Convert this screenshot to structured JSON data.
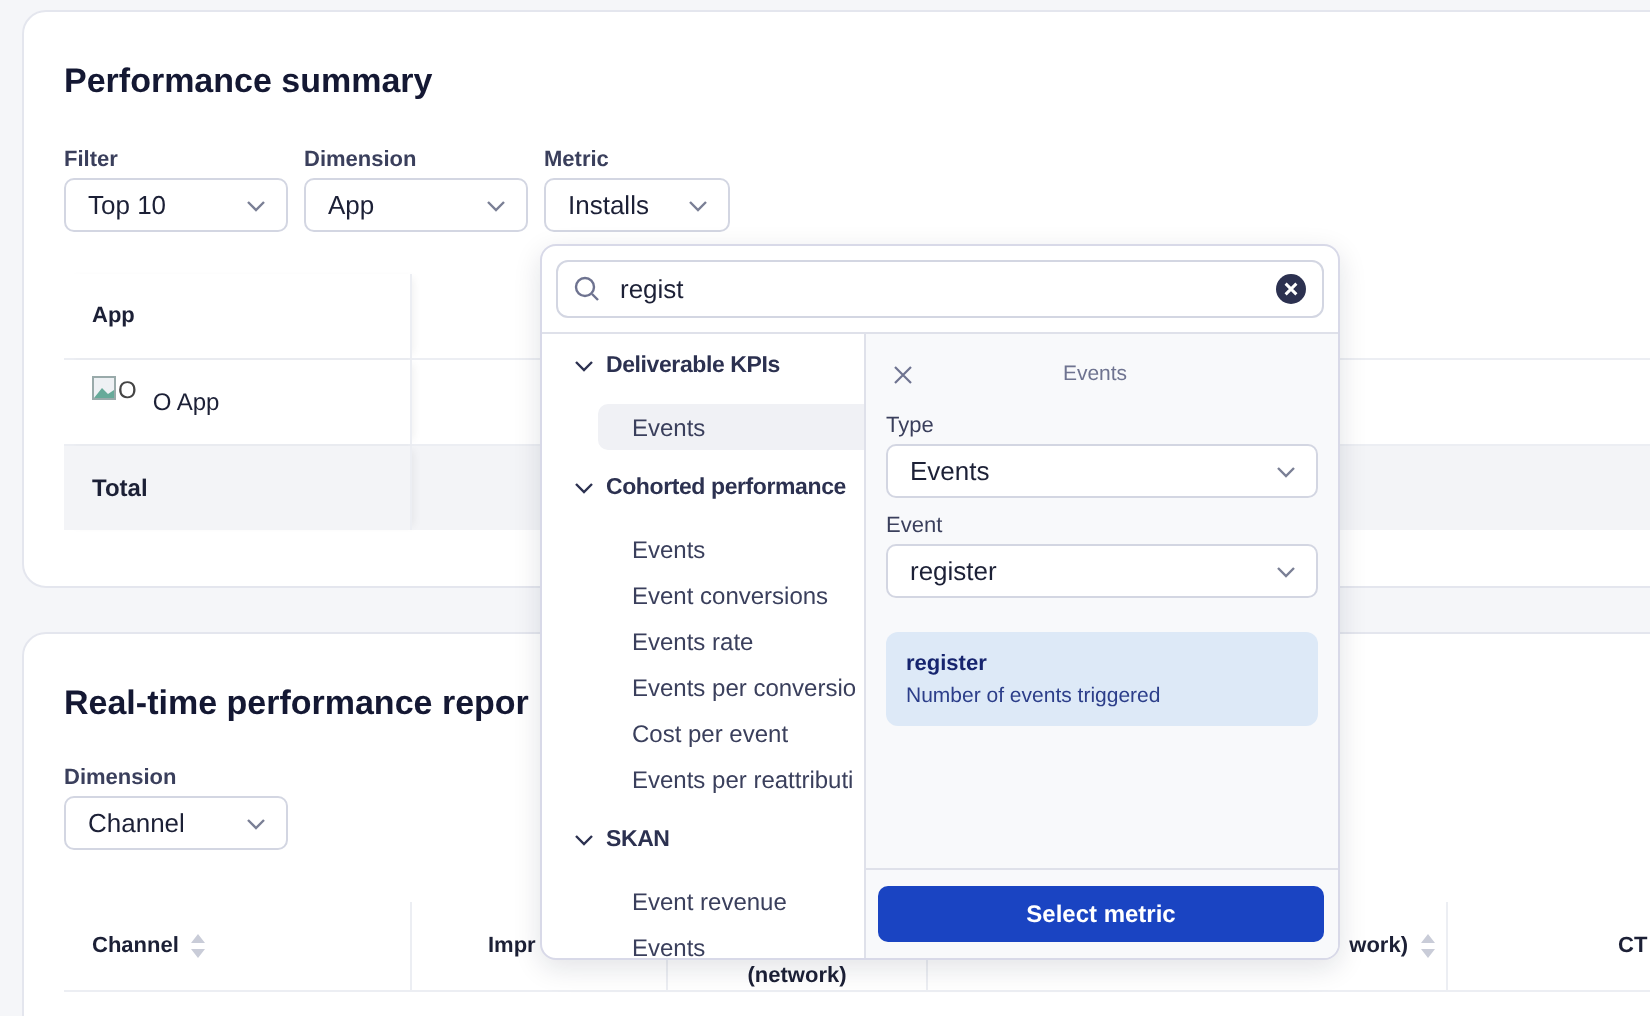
{
  "performance_summary": {
    "title": "Performance summary",
    "filters": [
      {
        "label": "Filter",
        "value": "Top 10"
      },
      {
        "label": "Dimension",
        "value": "App"
      },
      {
        "label": "Metric",
        "value": "Installs"
      }
    ],
    "table": {
      "columns": [
        "App"
      ],
      "rows": [
        {
          "icon_alt": "O",
          "name": "O App"
        }
      ],
      "total_label": "Total"
    }
  },
  "metric_picker": {
    "search": {
      "value": "regist"
    },
    "groups": [
      {
        "label": "Deliverable KPIs",
        "expanded": true,
        "items": [
          {
            "label": "Events",
            "selected": true
          }
        ]
      },
      {
        "label": "Cohorted performance",
        "expanded": true,
        "items": [
          {
            "label": "Events",
            "selected": false
          },
          {
            "label": "Event conversions",
            "selected": false
          },
          {
            "label": "Events rate",
            "selected": false
          },
          {
            "label": "Events per conversio",
            "selected": false
          },
          {
            "label": "Cost per event",
            "selected": false
          },
          {
            "label": "Events per reattributi",
            "selected": false
          }
        ]
      },
      {
        "label": "SKAN",
        "expanded": true,
        "items": [
          {
            "label": "Event revenue",
            "selected": false
          },
          {
            "label": "Events",
            "selected": false
          }
        ]
      }
    ],
    "detail": {
      "title": "Events",
      "type_label": "Type",
      "type_value": "Events",
      "event_label": "Event",
      "event_value": "register",
      "info": {
        "title": "register",
        "description": "Number of events triggered"
      },
      "button": "Select metric"
    }
  },
  "realtime_report": {
    "title": "Real-time performance repor",
    "filters": [
      {
        "label": "Dimension",
        "value": "Channel"
      }
    ],
    "table": {
      "columns": [
        {
          "label": "Channel",
          "sortable": true
        },
        {
          "label": "Impr"
        },
        {
          "label": "(network)"
        },
        {
          "label": "work)",
          "sortable": true
        },
        {
          "label": "CT"
        }
      ]
    }
  }
}
